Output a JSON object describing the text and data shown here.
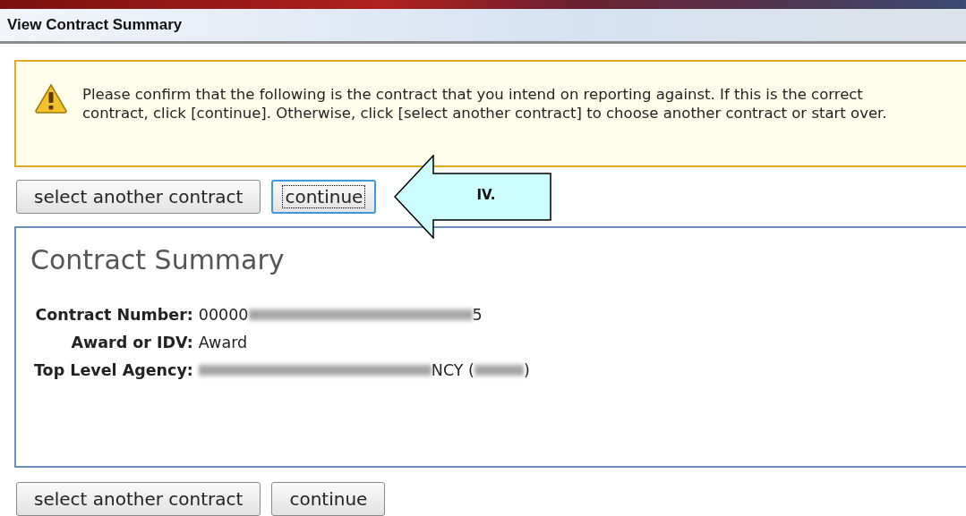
{
  "page_title": "View Contract Summary",
  "warning": {
    "message": "Please confirm that the following is the contract that you intend on reporting against. If this is the correct contract, click [continue]. Otherwise, click [select another contract] to choose another contract or start over."
  },
  "top_buttons": [
    {
      "label": "select another contract",
      "focused": false
    },
    {
      "label": "continue",
      "focused": true
    }
  ],
  "callout": {
    "label": "IV."
  },
  "summary": {
    "heading": "Contract Summary",
    "fields": [
      {
        "label": "Contract Number:",
        "segments": [
          {
            "kind": "text",
            "text": "00000"
          },
          {
            "kind": "redaction"
          },
          {
            "kind": "text",
            "text": "5"
          }
        ]
      },
      {
        "label": "Award or IDV:",
        "segments": [
          {
            "kind": "text",
            "text": "Award"
          }
        ]
      },
      {
        "label": "Top Level Agency:",
        "segments": [
          {
            "kind": "redaction"
          },
          {
            "kind": "text",
            "text": "NCY ("
          },
          {
            "kind": "redaction"
          },
          {
            "kind": "text",
            "text": ")"
          }
        ]
      }
    ]
  },
  "bottom_buttons": [
    {
      "label": "select another contract",
      "focused": false
    },
    {
      "label": "continue",
      "focused": false
    }
  ]
}
